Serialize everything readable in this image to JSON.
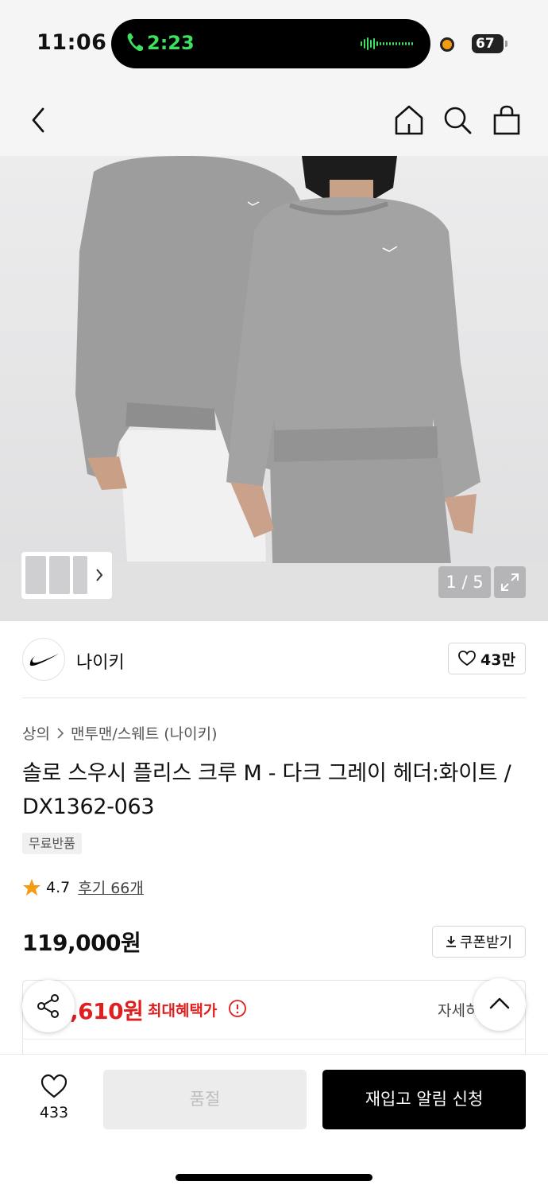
{
  "status_bar": {
    "time": "11:06",
    "call_duration": "2:23",
    "battery": "67"
  },
  "nav": {
    "back_icon": "chevron-left-icon",
    "home_icon": "home-icon",
    "search_icon": "search-icon",
    "bag_icon": "shopping-bag-icon"
  },
  "gallery": {
    "counter": "1 / 5",
    "expand_icon": "expand-icon",
    "thumbnail_more_icon": "chevron-right-icon"
  },
  "brand": {
    "name": "나이키",
    "logo_icon": "nike-swoosh-icon",
    "favorite_count": "43만"
  },
  "product": {
    "breadcrumb": [
      "상의",
      "맨투맨/스웨트 (나이키)"
    ],
    "title": "솔로 스우시 플리스 크루 M - 다크 그레이 헤더:화이트 / DX1362-063",
    "tag": "무료반품",
    "rating": "4.7",
    "review_link": "후기 66개",
    "price": "119,000원",
    "coupon_button": "쿠폰받기"
  },
  "benefit": {
    "price": ",610원",
    "label": "최대혜택가",
    "detail_link": "자세히"
  },
  "bottom_bar": {
    "like_count": "433",
    "soldout_button": "품절",
    "restock_button": "재입고 알림 신청"
  },
  "colors": {
    "accent_red": "#e0201f",
    "call_green": "#3ee060",
    "star": "#f29d13",
    "button_black": "#000000"
  }
}
